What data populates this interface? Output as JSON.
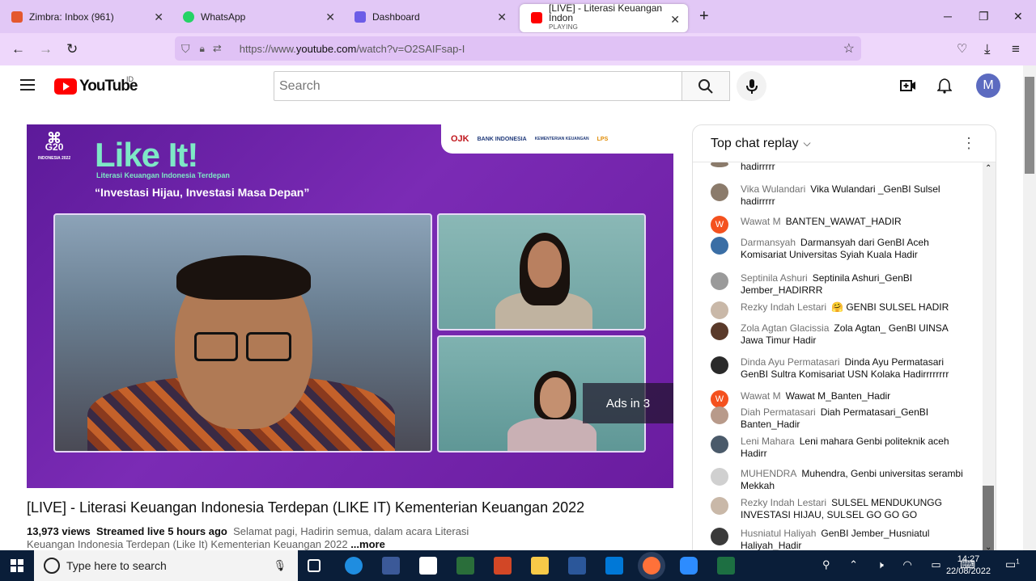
{
  "browser": {
    "tabs": [
      {
        "title": "Zimbra: Inbox (961)",
        "favicon_color": "#e4572e"
      },
      {
        "title": "WhatsApp",
        "favicon_color": "#25d366"
      },
      {
        "title": "Dashboard",
        "favicon_color": "#6c5ce7"
      },
      {
        "title": "[LIVE] - Literasi Keuangan Indon",
        "subtitle": "PLAYING",
        "favicon_color": "#ff0000"
      }
    ],
    "url_prefix": "https://www.",
    "url_domain": "youtube.com",
    "url_rest": "/watch?v=O2SAIFsap-I"
  },
  "youtube": {
    "logo": "YouTube",
    "country": "ID",
    "search_placeholder": "Search",
    "avatar_letter": "M"
  },
  "video": {
    "g20": "G20",
    "g20_sub": "INDONESIA 2022",
    "brand": "Like It!",
    "brand_sub": "Literasi Keuangan Indonesia Terdepan",
    "tagline": "“Investasi Hijau, Investasi Masa Depan”",
    "partners": [
      "OJK",
      "BANK INDONESIA",
      "KEMENTERIAN KEUANGAN",
      "LPS"
    ],
    "ads_label": "Ads in 3",
    "title": "[LIVE] - Literasi Keuangan Indonesia Terdepan (LIKE IT) Kementerian Keuangan 2022",
    "views": "13,973 views",
    "streamed": "Streamed live 5 hours ago",
    "description": "Selamat pagi, Hadirin semua, dalam acara Literasi Keuangan Indonesia Terdepan (Like It) Kementerian Keuangan 2022",
    "more": "...more"
  },
  "chat": {
    "header": "Top chat replay",
    "partial_top": "hadirrrrr",
    "messages": [
      {
        "author": "Vika Wulandari",
        "text": "Vika Wulandari _GenBI Sulsel hadirrrrr",
        "avatar": "",
        "color": "#8b7b6b"
      },
      {
        "author": "Wawat M",
        "text": "BANTEN_WAWAT_HADIR",
        "avatar": "W",
        "color": "#f4511e"
      },
      {
        "author": "Darmansyah",
        "text": "Darmansyah dari GenBI Aceh Komisariat Universitas Syiah Kuala Hadir",
        "avatar": "",
        "color": "#3a6ea5"
      },
      {
        "author": "Septinila Ashuri",
        "text": "Septinila Ashuri_GenBI Jember_HADIRRR",
        "avatar": "",
        "color": "#9a9a9a"
      },
      {
        "author": "Rezky Indah Lestari",
        "text": "🤗 GENBI SULSEL HADIR",
        "avatar": "",
        "color": "#c9b8a8"
      },
      {
        "author": "Zola Agtan Glacissia",
        "text": "Zola Agtan_ GenBI UINSA Jawa Timur Hadir",
        "avatar": "",
        "color": "#5a3a2a"
      },
      {
        "author": "Dinda Ayu Permatasari",
        "text": "Dinda Ayu Permatasari GenBI Sultra Komisariat USN Kolaka Hadirrrrrrrr",
        "avatar": "",
        "color": "#2a2a2a"
      },
      {
        "author": "Wawat M",
        "text": "Wawat M_Banten_Hadir",
        "avatar": "W",
        "color": "#f4511e"
      },
      {
        "author": "Diah Permatasari",
        "text": "Diah Permatasari_GenBI Banten_Hadir",
        "avatar": "",
        "color": "#b89a8a"
      },
      {
        "author": "Leni Mahara",
        "text": "Leni mahara Genbi politeknik aceh Hadirr",
        "avatar": "",
        "color": "#4a5a6a"
      },
      {
        "author": "MUHENDRA",
        "text": "Muhendra, Genbi universitas serambi Mekkah",
        "avatar": "",
        "color": "#d0d0d0"
      },
      {
        "author": "Rezky Indah Lestari",
        "text": "SULSEL MENDUKUNGG INVESTASI HIJAU, SULSEL GO GO GO",
        "avatar": "",
        "color": "#c9b8a8"
      },
      {
        "author": "Husniatul Haliyah",
        "text": "GenBI Jember_Husniatul Haliyah_Hadir",
        "avatar": "",
        "color": "#3a3a3a"
      }
    ]
  },
  "taskbar": {
    "search_placeholder": "Type here to search",
    "time": "14:27",
    "date": "22/08/2022",
    "notif_count": "1"
  }
}
